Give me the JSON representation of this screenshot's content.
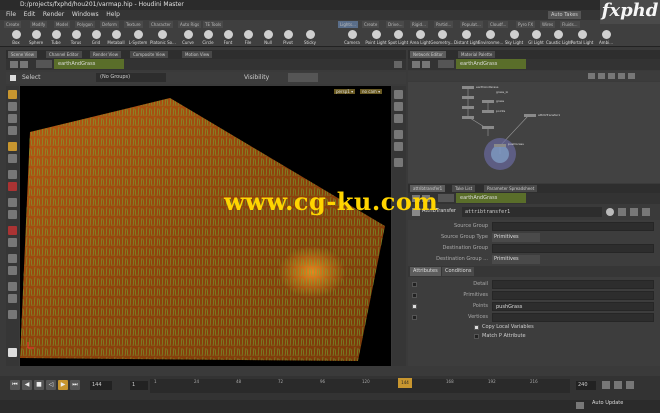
{
  "window": {
    "title": "D:/projects/fxphd/hou201/varmap.hip - Houdini Master"
  },
  "menu": [
    "File",
    "Edit",
    "Render",
    "Windows",
    "Help"
  ],
  "shelf_left": {
    "tabs": [
      "Create",
      "Modify",
      "Model",
      "Polygon",
      "Deform",
      "Texture",
      "Character",
      "Auto Rigs",
      "TE Tools"
    ],
    "tools": [
      "Box",
      "Sphere",
      "Tube",
      "Torus",
      "Grid",
      "Metaball",
      "L-System",
      "Platonic So...",
      "Curve",
      "Circle",
      "Font",
      "File",
      "Null",
      "Pivot",
      "Sticky"
    ]
  },
  "shelf_right": {
    "tabs": [
      "Lights...",
      "Create",
      "Drive...",
      "Rigid...",
      "Partid...",
      "Populat...",
      "Cloudf...",
      "Pyro FX",
      "Wires",
      "Fluids..."
    ],
    "tools": [
      "Camera",
      "Point Light",
      "Spot Light",
      "Area Light",
      "Geometry...",
      "Distant Light",
      "Environme...",
      "Sky Light",
      "GI Light",
      "Caustic Light",
      "Portal Light",
      "Ambi..."
    ]
  },
  "auto_takes": "Auto Takes",
  "logo": "fxphd",
  "viewport": {
    "tabs": [
      "Scene View",
      "Channel Editor",
      "Render View",
      "Composite View",
      "Motion View"
    ],
    "path": "earthAndGrass",
    "select_label": "Select",
    "group_value": "(No Groups)",
    "visibility_label": "Visibility",
    "badge_persp": "persp1 ▾",
    "badge_cam": "no cam ▾"
  },
  "network": {
    "tabs": [
      "Network Editor",
      "Material Palette"
    ],
    "path": "earthAndGrass",
    "nodes": [
      "earthAndGrass",
      "grass_lo",
      "grass",
      "points",
      "attribTransfer1",
      "pushGrass"
    ]
  },
  "params": {
    "tabs": [
      "attribtransfer1",
      "Take List",
      "Parameter Spreadsheet"
    ],
    "path": "earthAndGrass",
    "node_type": "AttribTransfer",
    "node_name": "attribtransfer1",
    "rows": [
      {
        "label": "Source Group",
        "value": ""
      },
      {
        "label": "Source Group Type",
        "value": "Primitives"
      },
      {
        "label": "Destination Group",
        "value": ""
      },
      {
        "label": "Destination Group ...",
        "value": "Primitives"
      }
    ],
    "sub_tabs": [
      "Attributes",
      "Conditions"
    ],
    "attr_rows": [
      {
        "label": "Detail",
        "value": ""
      },
      {
        "label": "Primitives",
        "value": ""
      },
      {
        "label": "Points",
        "value": "pushGrass"
      },
      {
        "label": "Vertices",
        "value": ""
      }
    ],
    "copy_local_vars": "Copy Local Variables",
    "match_p": "Match P Attribute"
  },
  "timeline": {
    "frame": "144",
    "start": "1",
    "end": "240",
    "current": "144",
    "ticks": [
      "1",
      "24",
      "48",
      "72",
      "96",
      "120",
      "144",
      "168",
      "192",
      "216",
      "240"
    ]
  },
  "status": {
    "auto_update": "Auto Update"
  },
  "watermark": "www.cg-ku.com",
  "colors": {
    "accent": "#c8962f",
    "path_highlight": "#5a6e2a",
    "grass": "#6fb63a",
    "ground": "#a24e10"
  }
}
